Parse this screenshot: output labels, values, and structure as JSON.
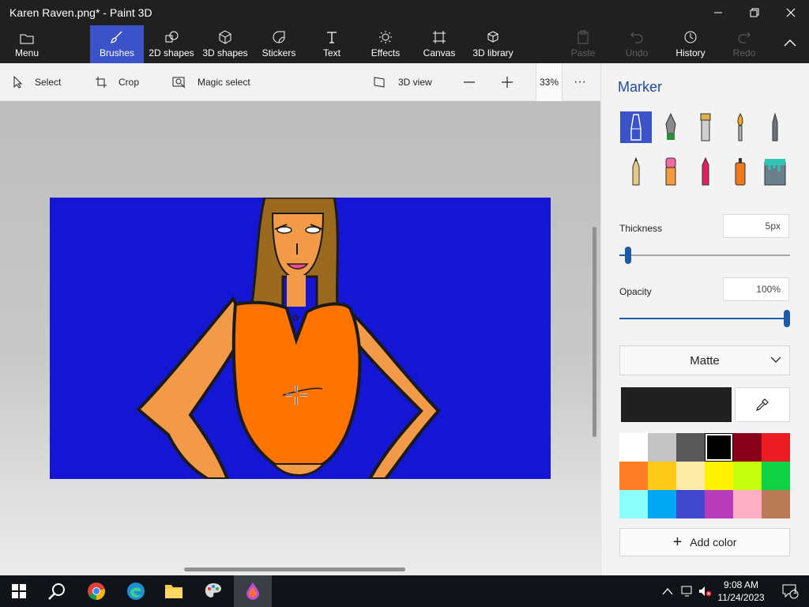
{
  "window": {
    "title": "Karen Raven.png* - Paint 3D"
  },
  "ribbon": {
    "menu": "Menu",
    "tabs": [
      "Brushes",
      "2D shapes",
      "3D shapes",
      "Stickers",
      "Text",
      "Effects",
      "Canvas",
      "3D library"
    ],
    "active_tab": "Brushes",
    "paste": "Paste",
    "undo": "Undo",
    "history": "History",
    "redo": "Redo"
  },
  "toolbar": {
    "select": "Select",
    "crop": "Crop",
    "magic_select": "Magic select",
    "view3d": "3D view",
    "zoom": "33%",
    "more": "···"
  },
  "panel": {
    "title": "Marker",
    "brushes": [
      "marker",
      "calligraphy-pen",
      "oil-brush",
      "watercolor",
      "pixel-pen",
      "pencil",
      "eraser",
      "crayon",
      "spray-can",
      "fill"
    ],
    "selected_brush": "marker",
    "thickness_label": "Thickness",
    "thickness_value": "5px",
    "thickness_level": 0.05,
    "opacity_label": "Opacity",
    "opacity_value": "100%",
    "opacity_level": 1.0,
    "finish": "Matte",
    "current_color": "#1f1f1f",
    "palette": [
      "#ffffff",
      "#c3c3c3",
      "#585858",
      "#000000",
      "#88001b",
      "#ec1c24",
      "#ff7f27",
      "#ffca18",
      "#fdeca6",
      "#fff200",
      "#c4ff0e",
      "#0ed145",
      "#8cfffb",
      "#00a8f3",
      "#3f48cc",
      "#b83dba",
      "#ffaec8",
      "#b97a56"
    ],
    "selected_swatch": 3,
    "add_color": "Add color"
  },
  "taskbar": {
    "apps": [
      "windows-start",
      "search",
      "chrome",
      "edge",
      "file-explorer",
      "paint",
      "paint-3d"
    ],
    "active_app": "paint-3d",
    "time": "9:08 AM",
    "date": "11/24/2023",
    "notifications": "1"
  }
}
